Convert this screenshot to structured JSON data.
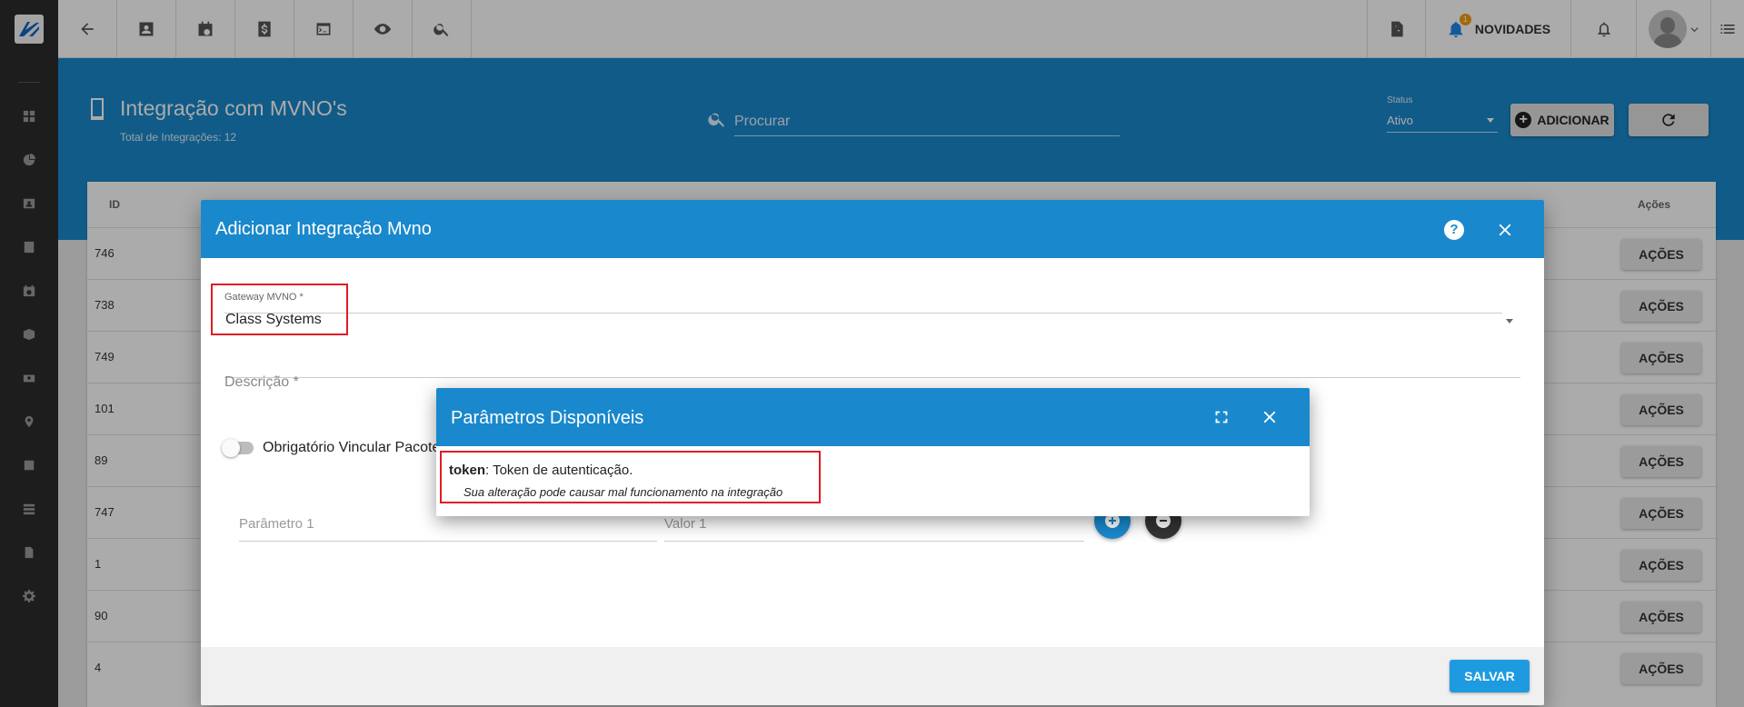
{
  "topbar": {
    "novidades_label": "NOVIDADES",
    "novidades_count": "1"
  },
  "header": {
    "title": "Integração com MVNO's",
    "subtitle": "Total de Integrações: 12",
    "search_placeholder": "Procurar",
    "status_label": "Status",
    "status_value": "Ativo",
    "add_label": "ADICIONAR"
  },
  "table": {
    "col_id": "ID",
    "col_acoes": "Ações",
    "acoes_label": "AÇÕES",
    "rows": [
      "746",
      "738",
      "749",
      "101",
      "89",
      "747",
      "1",
      "90",
      "4"
    ]
  },
  "dialog": {
    "title": "Adicionar Integração Mvno",
    "help": "?",
    "gateway_label": "Gateway MVNO *",
    "gateway_value": "Class Systems",
    "descricao_label": "Descrição *",
    "toggle_label": "Obrigatório Vincular Pacote",
    "param_placeholder": "Parâmetro 1",
    "valor_placeholder": "Valor 1",
    "save_label": "SALVAR"
  },
  "params_dialog": {
    "title": "Parâmetros Disponíveis",
    "token_name": "token",
    "token_desc": ": Token de autenticação.",
    "warning": "Sua alteração pode causar mal funcionamento na integração"
  },
  "colors": {
    "primary": "#1a88cc",
    "highlight": "#e01c24",
    "rail": "#2c2c2c"
  }
}
